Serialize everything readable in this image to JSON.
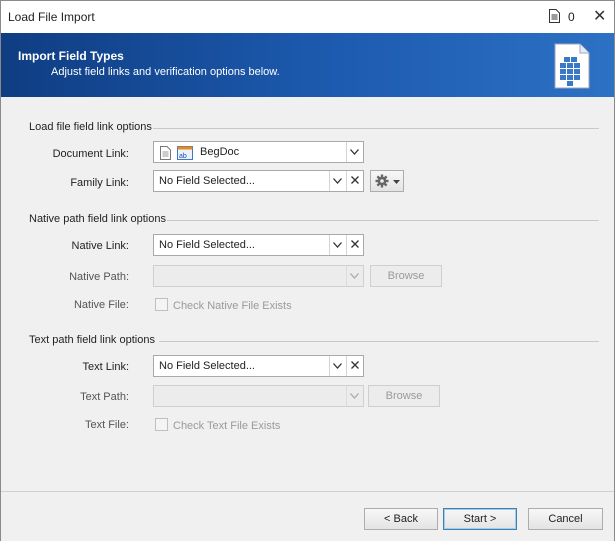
{
  "window": {
    "title": "Load File Import",
    "doc_count": "0"
  },
  "banner": {
    "heading": "Import Field Types",
    "subtitle": "Adjust field links and verification options below."
  },
  "load_file_section": {
    "heading": "Load file field link options",
    "document_link": {
      "label": "Document Link:",
      "value": "BegDoc"
    },
    "family_link": {
      "label": "Family Link:",
      "value": "No Field Selected..."
    }
  },
  "native_section": {
    "heading": "Native path field link options",
    "native_link": {
      "label": "Native Link:",
      "value": "No Field Selected..."
    },
    "native_path": {
      "label": "Native Path:",
      "value": "",
      "browse_label": "Browse"
    },
    "native_file": {
      "label": "Native File:",
      "checkbox_label": "Check Native File Exists"
    }
  },
  "text_section": {
    "heading": "Text path field link options",
    "text_link": {
      "label": "Text Link:",
      "value": "No Field Selected..."
    },
    "text_path": {
      "label": "Text Path:",
      "value": "",
      "browse_label": "Browse"
    },
    "text_file": {
      "label": "Text File:",
      "checkbox_label": "Check Text File Exists"
    }
  },
  "footer": {
    "back_label": "< Back",
    "start_label": "Start >",
    "cancel_label": "Cancel"
  },
  "colors": {
    "banner": "#1d5bb0",
    "window_bg": "#f0f0f0"
  }
}
